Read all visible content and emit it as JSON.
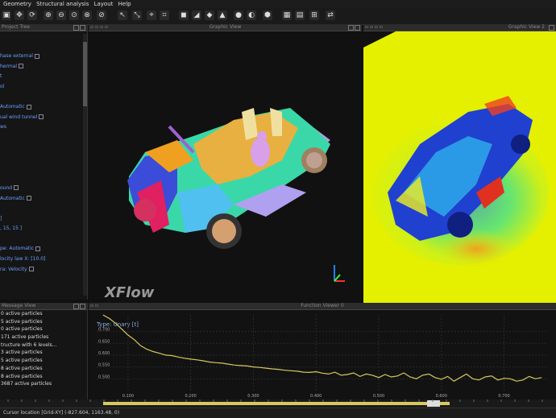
{
  "menu": [
    "Geometry",
    "Structural analysis",
    "Layout",
    "Help"
  ],
  "tree": {
    "title": "Project Tree",
    "rows": [
      {
        "text": "",
        "check": false
      },
      {
        "text": "",
        "check": false
      },
      {
        "text": "hase external",
        "check": true
      },
      {
        "text": "hermal",
        "check": true
      },
      {
        "text": "t",
        "check": false
      },
      {
        "text": "ol",
        "check": false
      },
      {
        "text": "",
        "check": false
      },
      {
        "text": "Automatic",
        "check": true
      },
      {
        "text": "ual wind tunnel",
        "check": true
      },
      {
        "text": "ws",
        "check": false
      },
      {
        "text": "",
        "check": false
      },
      {
        "text": "",
        "check": false
      },
      {
        "text": "",
        "check": false
      },
      {
        "text": "",
        "check": false
      },
      {
        "text": "",
        "check": false
      },
      {
        "text": "ound",
        "check": true
      },
      {
        "text": "Automatic",
        "check": true
      },
      {
        "text": "",
        "check": false
      },
      {
        "text": "]",
        "check": false
      },
      {
        "text": ", 15, 15 ]",
        "check": false
      },
      {
        "text": "",
        "check": false
      },
      {
        "text": "pe: Automatic",
        "check": true
      },
      {
        "text": "locity law X: [10.0]",
        "check": false
      },
      {
        "text": "ra: Velocity",
        "check": true
      },
      {
        "text": "",
        "check": false
      },
      {
        "text": "",
        "check": false
      },
      {
        "text": "",
        "check": false
      },
      {
        "text": "20.995",
        "check": false
      },
      {
        "text": "",
        "check": false
      },
      {
        "text": "",
        "check": false
      },
      {
        "text": "ature: 288.15",
        "check": false
      }
    ]
  },
  "gv1": {
    "title": "Graphic View",
    "watermark": "XFlow"
  },
  "gv2": {
    "title": "Graphic View 2"
  },
  "message": {
    "title": "Message View",
    "rows": [
      "0 active particles",
      "5 active particles",
      "0 active particles",
      "171 active particles",
      "tructure with 6 levels...",
      "3 active particles",
      "5 active particles",
      "8 active particles",
      "8 active particles",
      "3687 active particles"
    ]
  },
  "fv": {
    "title": "Function Viewer 0",
    "type_label": "Type: Unary [t]"
  },
  "status": {
    "cursor": "Cursor location [Grid-XY] (-827.604, 1163.48, 0)"
  },
  "colors": {
    "accent": "#d8c860",
    "cfd_bg": "#e8f000"
  },
  "chart_data": {
    "type": "line",
    "title": "",
    "xlabel": "",
    "ylabel": "",
    "xlim": [
      0.05,
      0.77
    ],
    "ylim": [
      0.45,
      0.77
    ],
    "x_ticks": [
      0.1,
      0.2,
      0.3,
      0.4,
      0.5,
      0.6,
      0.7
    ],
    "x_tick_labels": [
      "0.100",
      "0.200",
      "0.300",
      "0.400",
      "0.500",
      "0.600",
      "0.700"
    ],
    "y_ticks": [
      0.5,
      0.55,
      0.6,
      0.65,
      0.7
    ],
    "y_tick_labels": [
      "0.500",
      "0.550",
      "0.600",
      "0.650",
      "0.700"
    ],
    "series": [
      {
        "x": [
          0.06,
          0.07,
          0.08,
          0.09,
          0.1,
          0.11,
          0.12,
          0.13,
          0.14,
          0.15,
          0.16,
          0.17,
          0.18,
          0.19,
          0.2,
          0.21,
          0.22,
          0.23,
          0.24,
          0.25,
          0.26,
          0.27,
          0.28,
          0.29,
          0.3,
          0.31,
          0.32,
          0.33,
          0.34,
          0.35,
          0.36,
          0.37,
          0.38,
          0.39,
          0.4,
          0.41,
          0.42,
          0.43,
          0.44,
          0.45,
          0.46,
          0.47,
          0.48,
          0.49,
          0.5,
          0.51,
          0.52,
          0.53,
          0.54,
          0.55,
          0.56,
          0.57,
          0.58,
          0.59,
          0.6,
          0.61,
          0.62,
          0.63,
          0.64,
          0.65,
          0.66,
          0.67,
          0.68,
          0.69,
          0.7,
          0.71,
          0.72,
          0.73,
          0.74,
          0.75,
          0.76
        ],
        "y": [
          0.77,
          0.755,
          0.735,
          0.71,
          0.685,
          0.665,
          0.64,
          0.625,
          0.615,
          0.608,
          0.6,
          0.598,
          0.592,
          0.587,
          0.583,
          0.58,
          0.576,
          0.571,
          0.568,
          0.566,
          0.562,
          0.558,
          0.556,
          0.554,
          0.55,
          0.548,
          0.545,
          0.542,
          0.54,
          0.536,
          0.534,
          0.532,
          0.528,
          0.527,
          0.53,
          0.524,
          0.52,
          0.528,
          0.515,
          0.518,
          0.525,
          0.51,
          0.52,
          0.515,
          0.505,
          0.518,
          0.508,
          0.512,
          0.525,
          0.508,
          0.5,
          0.515,
          0.52,
          0.505,
          0.498,
          0.51,
          0.49,
          0.505,
          0.52,
          0.5,
          0.495,
          0.508,
          0.512,
          0.495,
          0.502,
          0.5,
          0.49,
          0.495,
          0.51,
          0.5,
          0.505
        ]
      }
    ]
  }
}
